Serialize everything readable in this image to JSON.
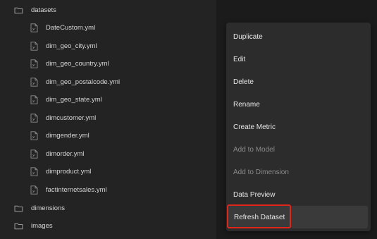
{
  "tree": {
    "folders": {
      "datasets": "datasets",
      "dimensions": "dimensions",
      "images": "images"
    },
    "dataset_files": [
      "DateCustom.yml",
      "dim_geo_city.yml",
      "dim_geo_country.yml",
      "dim_geo_postalcode.yml",
      "dim_geo_state.yml",
      "dimcustomer.yml",
      "dimgender.yml",
      "dimorder.yml",
      "dimproduct.yml",
      "factinternetsales.yml"
    ]
  },
  "context_menu": {
    "items": [
      {
        "label": "Duplicate",
        "enabled": true
      },
      {
        "label": "Edit",
        "enabled": true
      },
      {
        "label": "Delete",
        "enabled": true
      },
      {
        "label": "Rename",
        "enabled": true
      },
      {
        "label": "Create Metric",
        "enabled": true
      },
      {
        "label": "Add to Model",
        "enabled": false
      },
      {
        "label": "Add to Dimension",
        "enabled": false
      },
      {
        "label": "Data Preview",
        "enabled": true
      },
      {
        "label": "Refresh Dataset",
        "enabled": true
      }
    ]
  },
  "colors": {
    "highlight_border": "#e0261b",
    "disabled_text": "#8a8a8a"
  },
  "icons": {
    "folder": "folder-icon",
    "file": "yaml-file-icon"
  }
}
